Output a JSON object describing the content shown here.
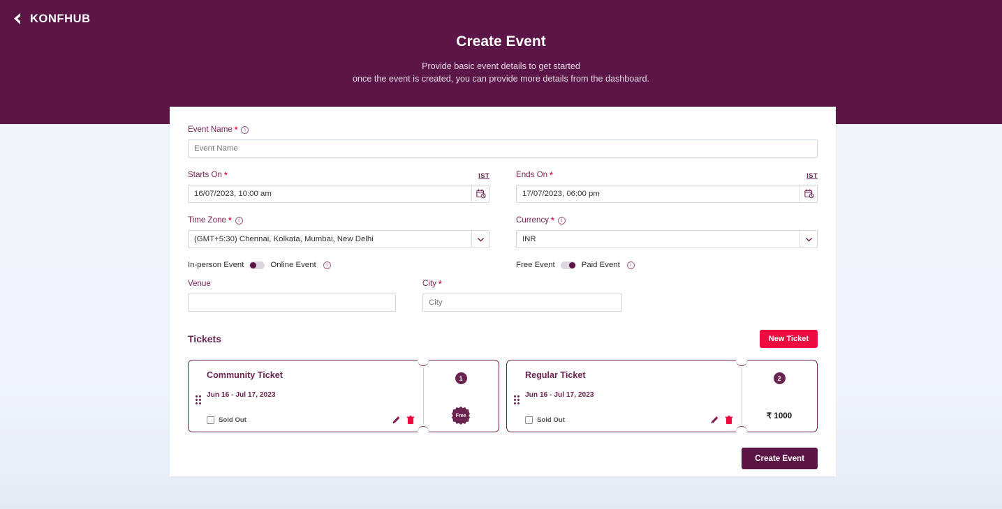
{
  "brand": {
    "logo_text": "KONFHUB",
    "header_bg": "#5b1546",
    "accent_red": "#ee0b3f",
    "label_purple": "#7a2254"
  },
  "banner": {
    "title": "Create Event",
    "subtitle_line1": "Provide basic event details to get started",
    "subtitle_line2": "once the event is created, you can provide more details from the dashboard."
  },
  "form": {
    "event_name": {
      "label": "Event Name",
      "required": "*",
      "placeholder": "Event Name",
      "value": ""
    },
    "starts_on": {
      "label": "Starts On",
      "required": "*",
      "timezone_badge": "IST",
      "value": "16/07/2023, 10:00 am"
    },
    "ends_on": {
      "label": "Ends On",
      "required": "*",
      "timezone_badge": "IST",
      "value": "17/07/2023, 06:00 pm"
    },
    "time_zone": {
      "label": "Time Zone",
      "required": "*",
      "value": "(GMT+5:30) Chennai, Kolkata, Mumbai, New Delhi"
    },
    "currency": {
      "label": "Currency",
      "required": "*",
      "value": "INR"
    },
    "event_mode_toggle": {
      "left_label": "In-person Event",
      "right_label": "Online Event",
      "state": "left"
    },
    "pricing_toggle": {
      "left_label": "Free Event",
      "right_label": "Paid Event",
      "state": "right"
    },
    "venue": {
      "label": "Venue",
      "placeholder": "",
      "value": ""
    },
    "city": {
      "label": "City",
      "required": "*",
      "placeholder": "City",
      "value": ""
    }
  },
  "tickets_section": {
    "title": "Tickets",
    "new_ticket_label": "New Ticket",
    "sold_out_label": "Sold Out",
    "tickets": [
      {
        "name": "Community Ticket",
        "dates": "Jun 16 - Jul 17, 2023",
        "quantity": "1",
        "price_display": "Free",
        "is_free": true,
        "sold_out": false
      },
      {
        "name": "Regular Ticket",
        "dates": "Jun 16 - Jul 17, 2023",
        "quantity": "2",
        "price_display": "₹ 1000",
        "is_free": false,
        "sold_out": false
      }
    ]
  },
  "footer": {
    "create_event_label": "Create Event"
  }
}
